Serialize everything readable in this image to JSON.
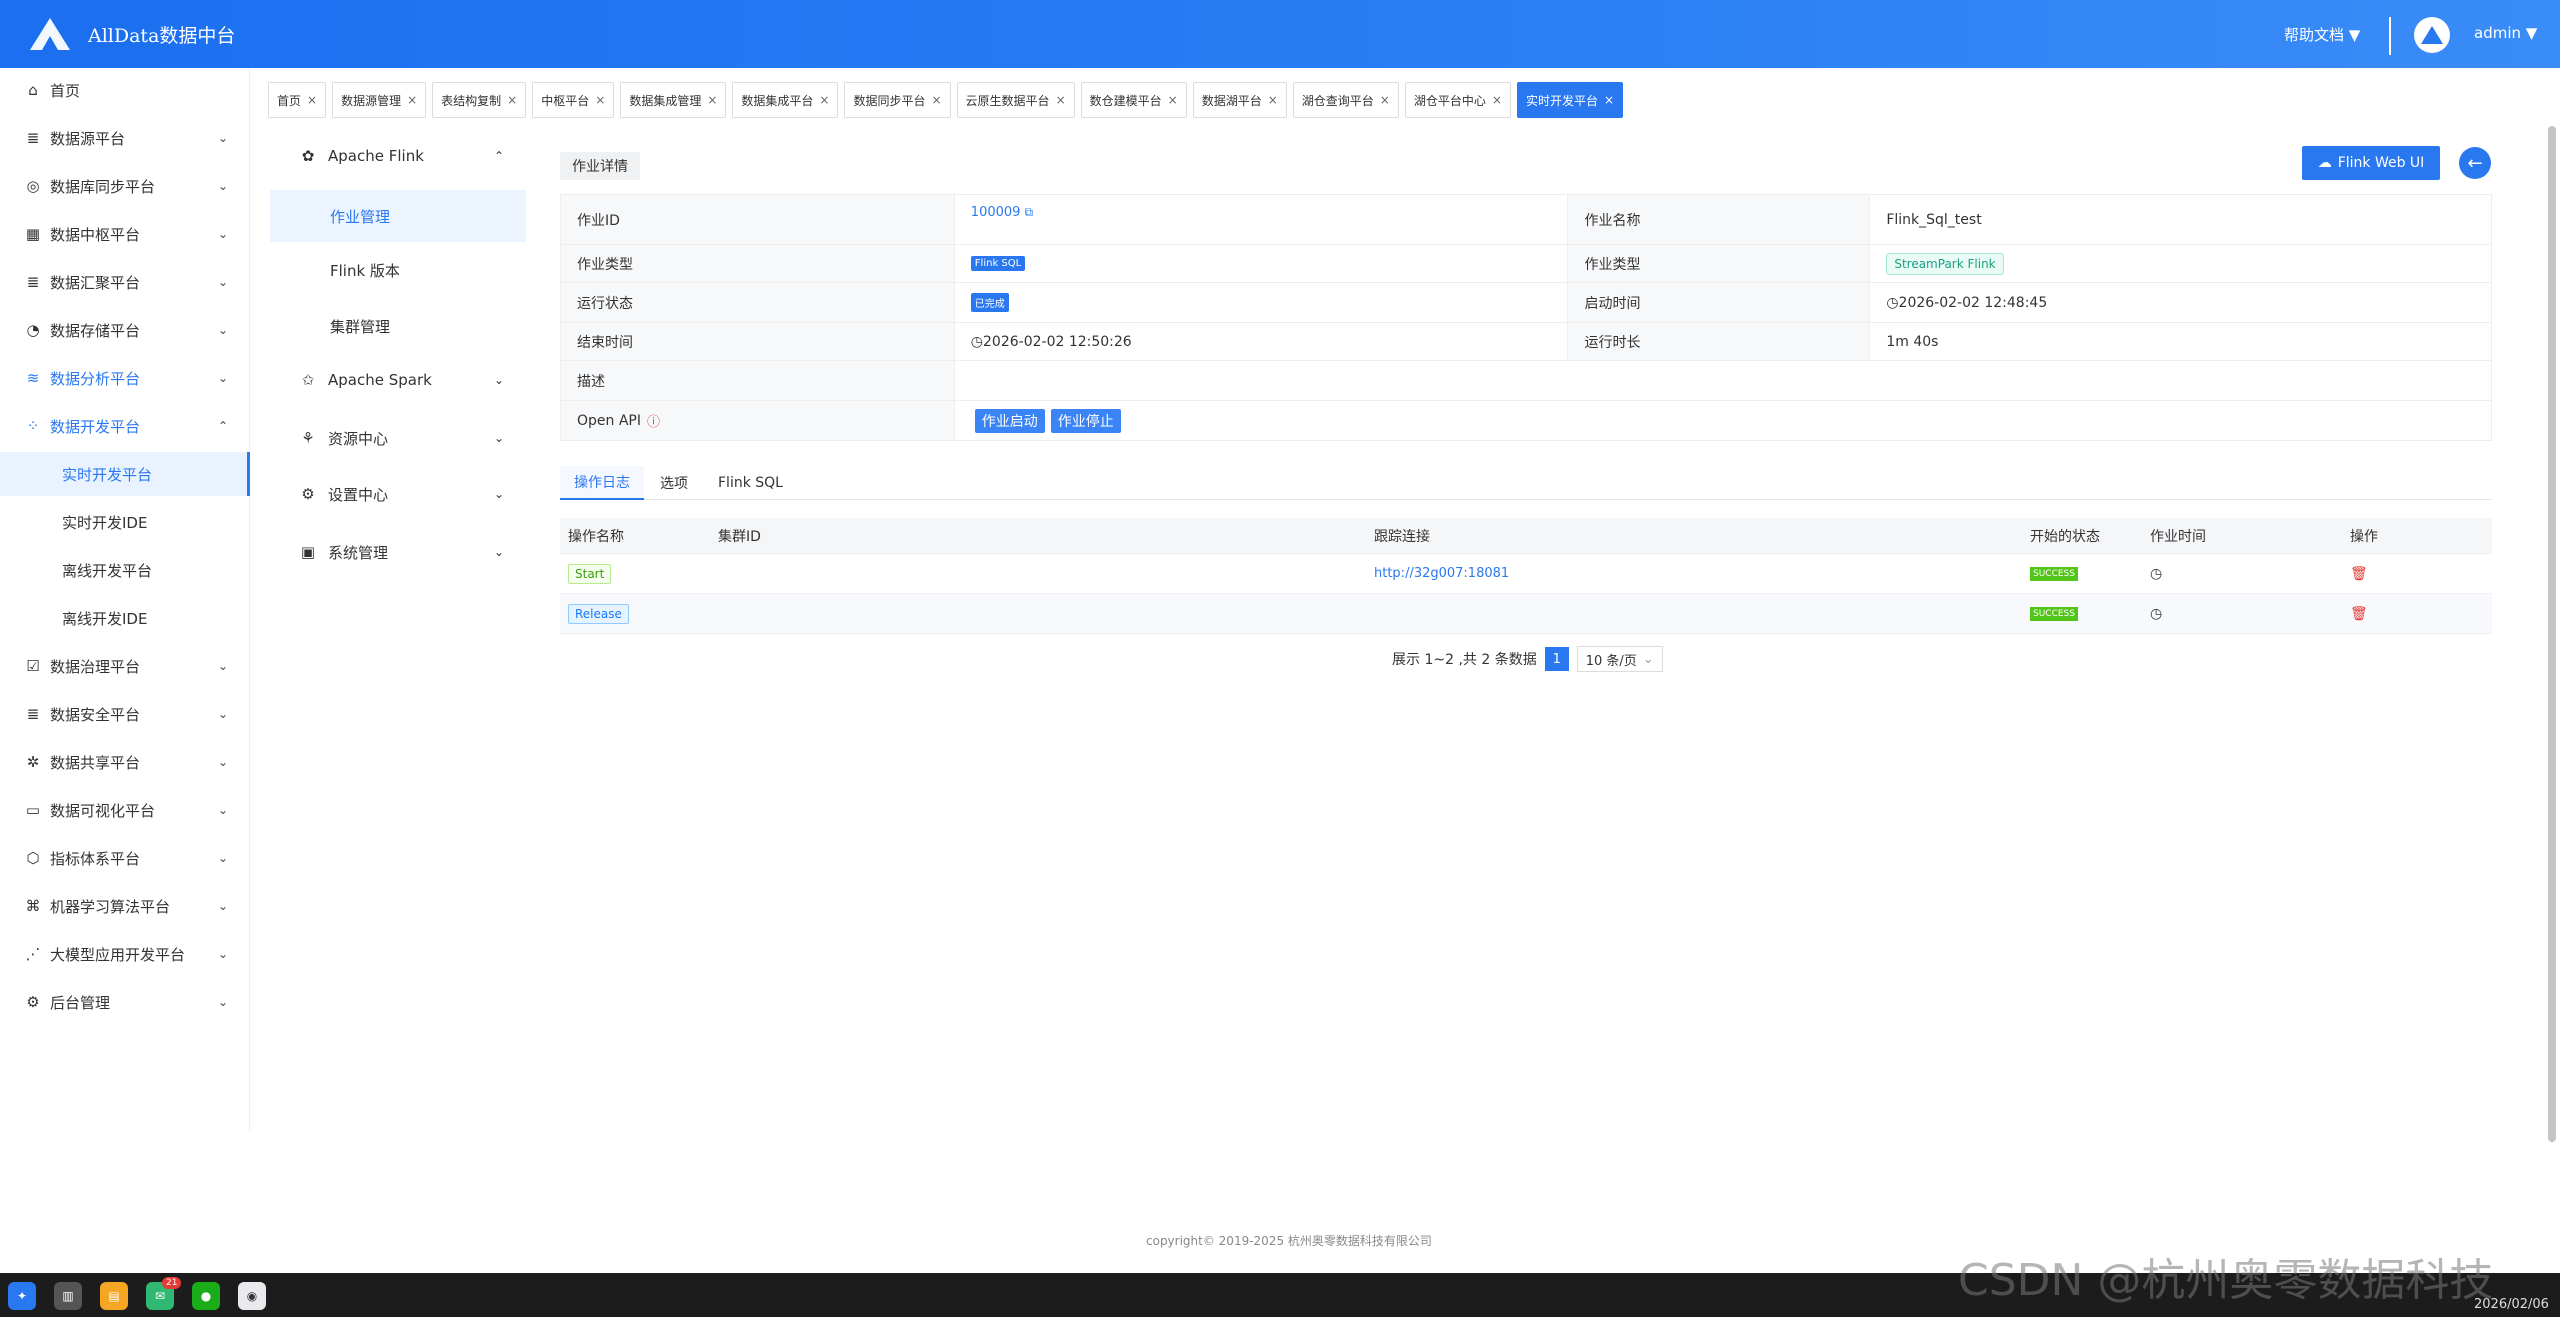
{
  "app": {
    "title": "AllData数据中台",
    "help": "帮助文档",
    "user": "admin"
  },
  "sidebar": {
    "items": [
      {
        "label": "首页"
      },
      {
        "label": "数据源平台"
      },
      {
        "label": "数据库同步平台"
      },
      {
        "label": "数据中枢平台"
      },
      {
        "label": "数据汇聚平台"
      },
      {
        "label": "数据存储平台"
      },
      {
        "label": "数据分析平台"
      },
      {
        "label": "数据开发平台"
      },
      {
        "label": "实时开发平台"
      },
      {
        "label": "实时开发IDE"
      },
      {
        "label": "离线开发平台"
      },
      {
        "label": "离线开发IDE"
      },
      {
        "label": "数据治理平台"
      },
      {
        "label": "数据安全平台"
      },
      {
        "label": "数据共享平台"
      },
      {
        "label": "数据可视化平台"
      },
      {
        "label": "指标体系平台"
      },
      {
        "label": "机器学习算法平台"
      },
      {
        "label": "大模型应用开发平台"
      },
      {
        "label": "后台管理"
      }
    ]
  },
  "tabs": [
    {
      "label": "首页"
    },
    {
      "label": "数据源管理"
    },
    {
      "label": "表结构复制"
    },
    {
      "label": "中枢平台"
    },
    {
      "label": "数据集成管理"
    },
    {
      "label": "数据集成平台"
    },
    {
      "label": "数据同步平台"
    },
    {
      "label": "云原生数据平台"
    },
    {
      "label": "数仓建模平台"
    },
    {
      "label": "数据湖平台"
    },
    {
      "label": "湖仓查询平台"
    },
    {
      "label": "湖仓平台中心"
    },
    {
      "label": "实时开发平台"
    }
  ],
  "submenu": {
    "items": [
      {
        "label": "Apache Flink"
      },
      {
        "label": "作业管理"
      },
      {
        "label": "Flink 版本"
      },
      {
        "label": "集群管理"
      },
      {
        "label": "Apache Spark"
      },
      {
        "label": "资源中心"
      },
      {
        "label": "设置中心"
      },
      {
        "label": "系统管理"
      }
    ]
  },
  "detail": {
    "title": "作业详情",
    "flink_btn": "Flink Web UI",
    "job_id_label": "作业ID",
    "job_id": "100009",
    "job_name_label": "作业名称",
    "job_name": "Flink_Sql_test",
    "job_type_label": "作业类型",
    "job_type_chip": "Flink SQL",
    "job_type2_label": "作业类型",
    "job_type2": "StreamPark Flink",
    "run_state_label": "运行状态",
    "run_state": "已完成",
    "start_time_label": "启动时间",
    "start_time": "2026-02-02 12:48:45",
    "end_time_label": "结束时间",
    "end_time": "2026-02-02 12:50:26",
    "duration_label": "运行时长",
    "duration": "1m 40s",
    "desc_label": "描述",
    "openapi_label": "Open API",
    "start_btn": "作业启动",
    "stop_btn": "作业停止"
  },
  "logtabs": [
    {
      "label": "操作日志"
    },
    {
      "label": "选项"
    },
    {
      "label": "Flink SQL"
    }
  ],
  "log": {
    "headers": [
      "操作名称",
      "集群ID",
      "跟踪连接",
      "开始的状态",
      "作业时间",
      "操作"
    ],
    "rows": [
      {
        "name": "Start",
        "cluster": "",
        "link": "http://32g007:18081",
        "status": "SUCCESS"
      },
      {
        "name": "Release",
        "cluster": "",
        "link": "",
        "status": "SUCCESS"
      }
    ]
  },
  "pager": {
    "summary": "展示 1~2 ,共 2 条数据",
    "page": "1",
    "size": "10 条/页"
  },
  "footer": {
    "copyright": "copyright© 2019-2025 杭州奥零数据科技有限公司"
  },
  "taskbar": {
    "badge": "21",
    "date": "2026/02/06"
  },
  "watermark": "CSDN @杭州奥零数据科技",
  "colors": {
    "primary": "#2a78f0",
    "success": "#52c41a",
    "danger": "#e53935"
  }
}
